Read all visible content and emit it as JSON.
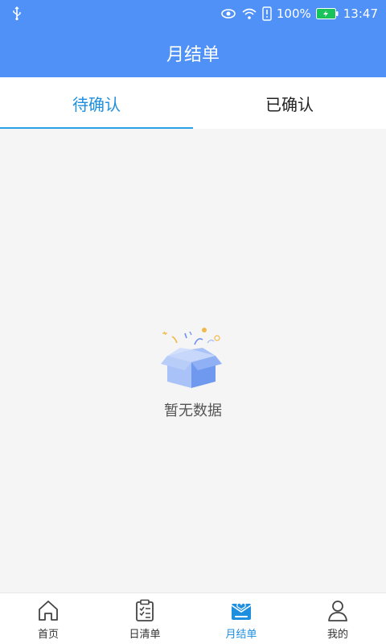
{
  "status_bar": {
    "battery": "100%",
    "time": "13:47",
    "icons": [
      "usb-icon",
      "eye-icon",
      "wifi-icon",
      "sim-alert-icon",
      "battery-charging-icon"
    ]
  },
  "header": {
    "title": "月结单"
  },
  "tabs": [
    {
      "label": "待确认",
      "active": true
    },
    {
      "label": "已确认",
      "active": false
    }
  ],
  "empty_state": {
    "message": "暂无数据",
    "icon": "empty-box-icon"
  },
  "bottom_nav": [
    {
      "label": "首页",
      "icon": "home-icon",
      "active": false
    },
    {
      "label": "日清单",
      "icon": "clipboard-list-icon",
      "active": false
    },
    {
      "label": "月结单",
      "icon": "monthly-statement-icon",
      "active": true
    },
    {
      "label": "我的",
      "icon": "user-icon",
      "active": false
    }
  ],
  "colors": {
    "primary": "#4f91f7",
    "active": "#1e8fdf",
    "background": "#f5f5f6"
  }
}
